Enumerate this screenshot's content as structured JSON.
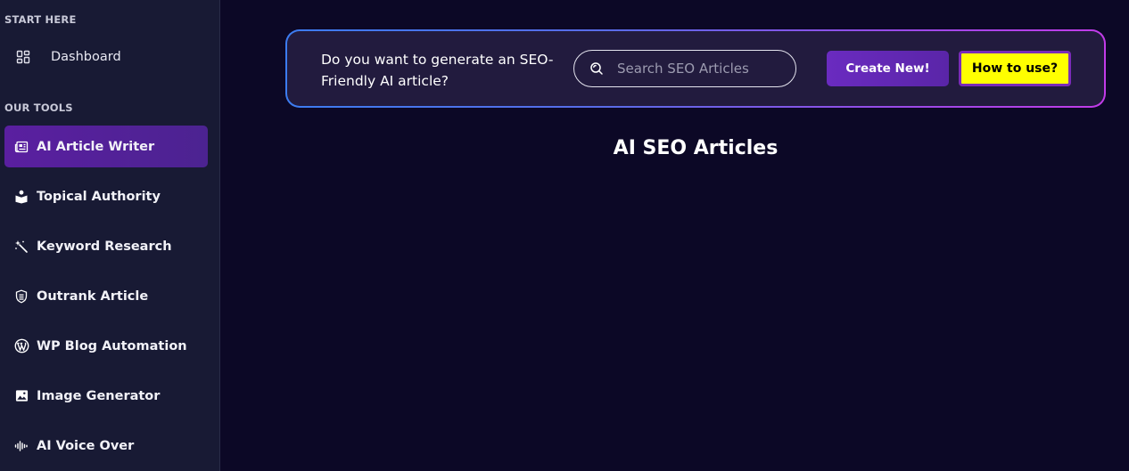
{
  "sidebar": {
    "start_here_label": "START HERE",
    "dashboard": {
      "label": "Dashboard",
      "icon": "dashboard-icon"
    },
    "our_tools_label": "OUR TOOLS",
    "items": [
      {
        "label": "AI Article Writer",
        "icon": "newspaper-icon",
        "active": true
      },
      {
        "label": "Topical Authority",
        "icon": "book-reader-icon",
        "active": false
      },
      {
        "label": "Keyword Research",
        "icon": "magic-wand-icon",
        "active": false
      },
      {
        "label": "Outrank Article",
        "icon": "shield-icon",
        "active": false
      },
      {
        "label": "WP Blog Automation",
        "icon": "wordpress-icon",
        "active": false
      },
      {
        "label": "Image Generator",
        "icon": "image-icon",
        "active": false
      },
      {
        "label": "AI Voice Over",
        "icon": "sound-wave-icon",
        "active": false
      }
    ]
  },
  "banner": {
    "prompt": "Do you want to generate an SEO-Friendly AI article?",
    "search_placeholder": "Search SEO Articles",
    "create_label": "Create New!",
    "howto_label": "How to use?"
  },
  "main": {
    "title": "AI SEO Articles"
  },
  "colors": {
    "background": "#0c0826",
    "sidebar": "#181a34",
    "active_item": "#5a1fa0",
    "create_button": "#6a2bc0",
    "howto_button": "#ffff00",
    "banner_border_start": "#3c7cf0",
    "banner_border_end": "#c23be8"
  }
}
